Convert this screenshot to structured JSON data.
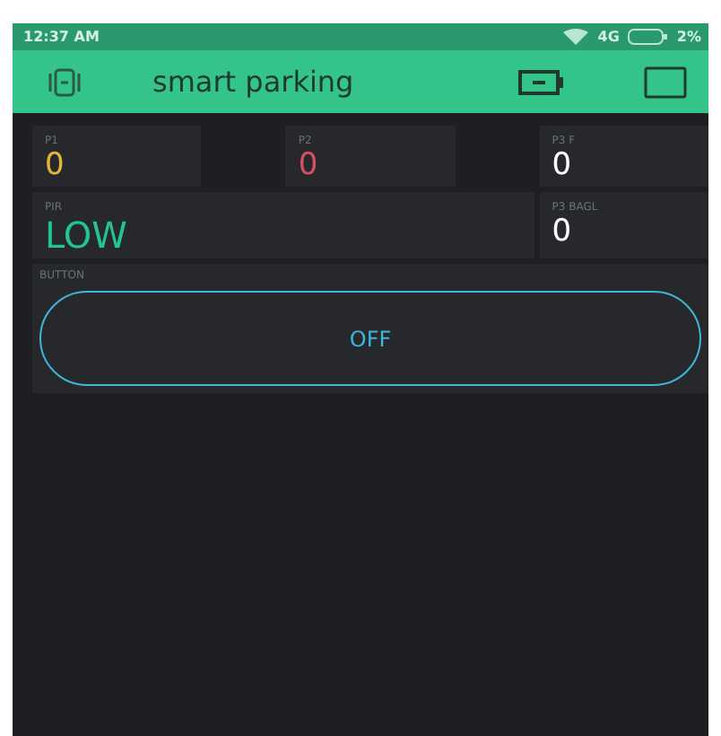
{
  "status_bar": {
    "time": "12:37 AM",
    "network": "4G",
    "battery": "2%"
  },
  "app_bar": {
    "title": "smart parking"
  },
  "widgets": [
    {
      "kind": "value",
      "label": "P1",
      "value": "0",
      "color": "#e3b33a"
    },
    {
      "kind": "value",
      "label": "P2",
      "value": "0",
      "color": "#d34f62"
    },
    {
      "kind": "value",
      "label": "P3 F",
      "value": "0",
      "color": "#ffffff"
    },
    {
      "kind": "value",
      "label": "PIR",
      "value": "LOW",
      "color": "#23c48e"
    },
    {
      "kind": "value",
      "label": "P3 BAGL",
      "value": "0",
      "color": "#ffffff"
    },
    {
      "kind": "button",
      "label": "BUTTON",
      "value": "OFF",
      "color": "#3fb6d8"
    }
  ]
}
